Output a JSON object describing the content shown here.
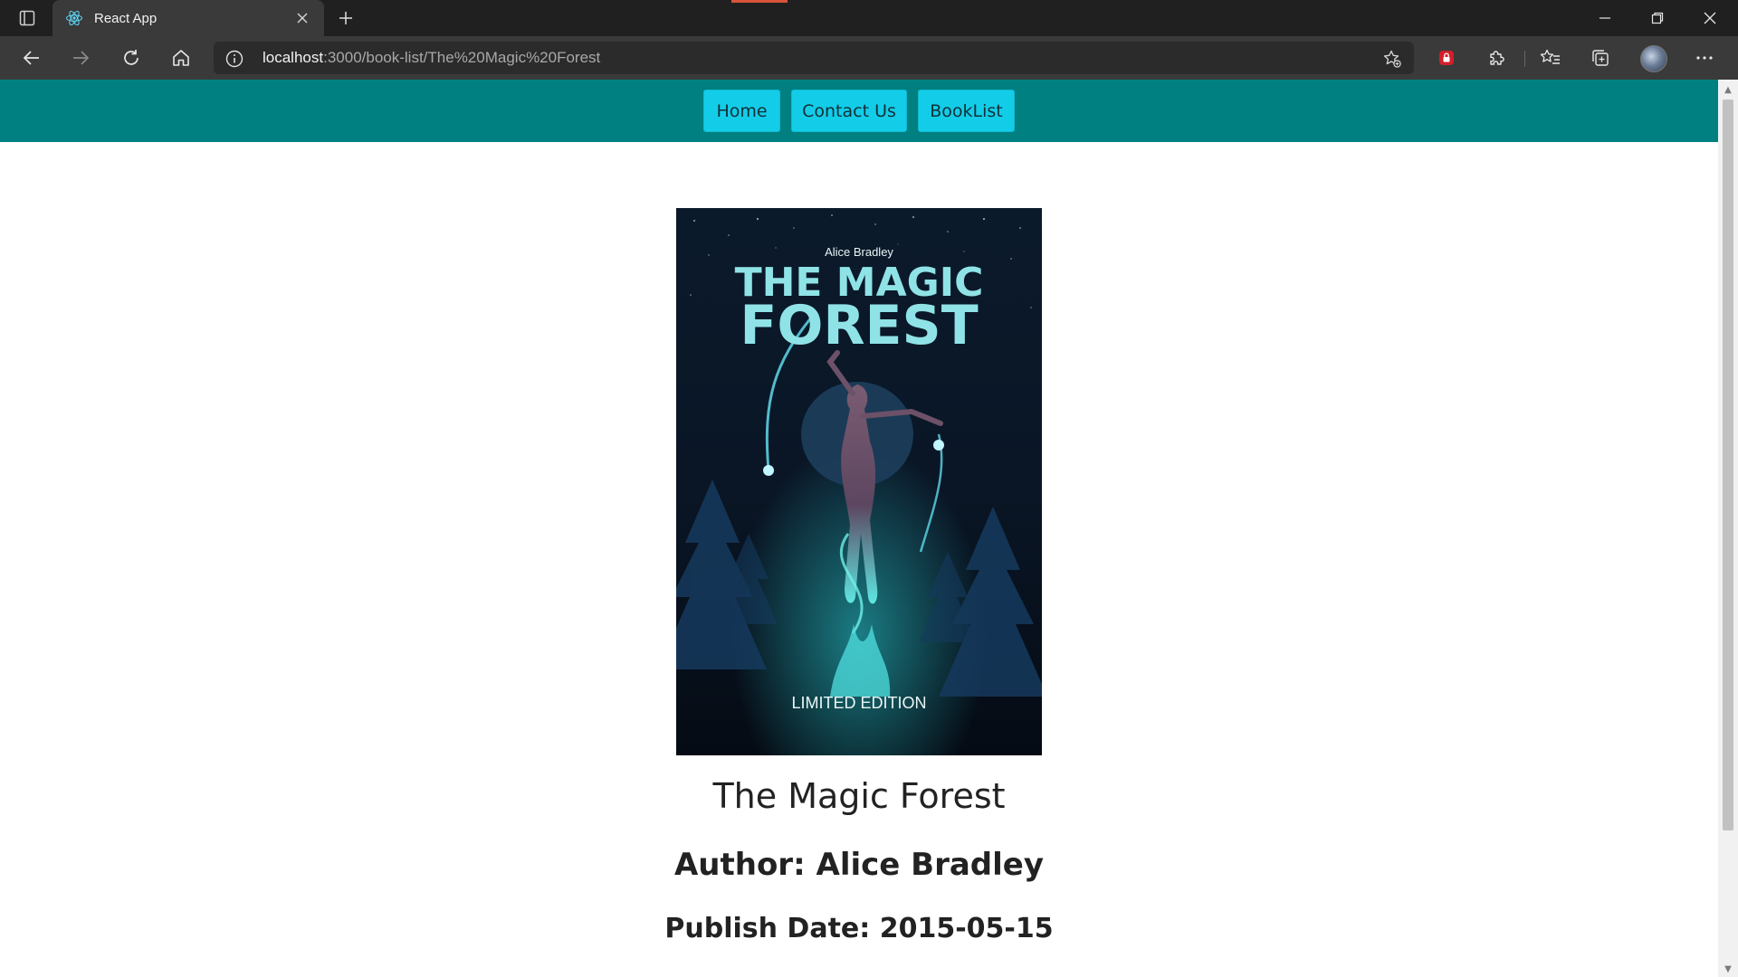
{
  "browser": {
    "tab": {
      "title": "React App",
      "favicon": "react-icon"
    },
    "address": {
      "host": "localhost",
      "path": ":3000/book-list/The%20Magic%20Forest"
    },
    "icons": {
      "back": "back-arrow-icon",
      "forward": "forward-arrow-icon",
      "refresh": "refresh-icon",
      "home": "home-icon",
      "info": "info-icon",
      "favorite": "add-favorite-icon",
      "extension_lock": "lock-extension-icon",
      "extensions": "puzzle-icon",
      "favorites": "favorites-list-icon",
      "collections": "collections-icon",
      "profile": "profile-avatar",
      "menu": "more-icon"
    }
  },
  "nav": {
    "home": "Home",
    "contact": "Contact Us",
    "booklist": "BookList"
  },
  "book": {
    "title": "The Magic Forest",
    "author_line": "Author: Alice Bradley",
    "date_line": "Publish Date: 2015-05-15",
    "cover": {
      "author": "Alice Bradley",
      "title_line1": "THE MAGIC",
      "title_line2": "FOREST",
      "tagline": "LIMITED EDITION"
    }
  },
  "colors": {
    "navbar": "#008080",
    "nav_button": "#13cde8",
    "cover_title": "#8fe3e6"
  }
}
